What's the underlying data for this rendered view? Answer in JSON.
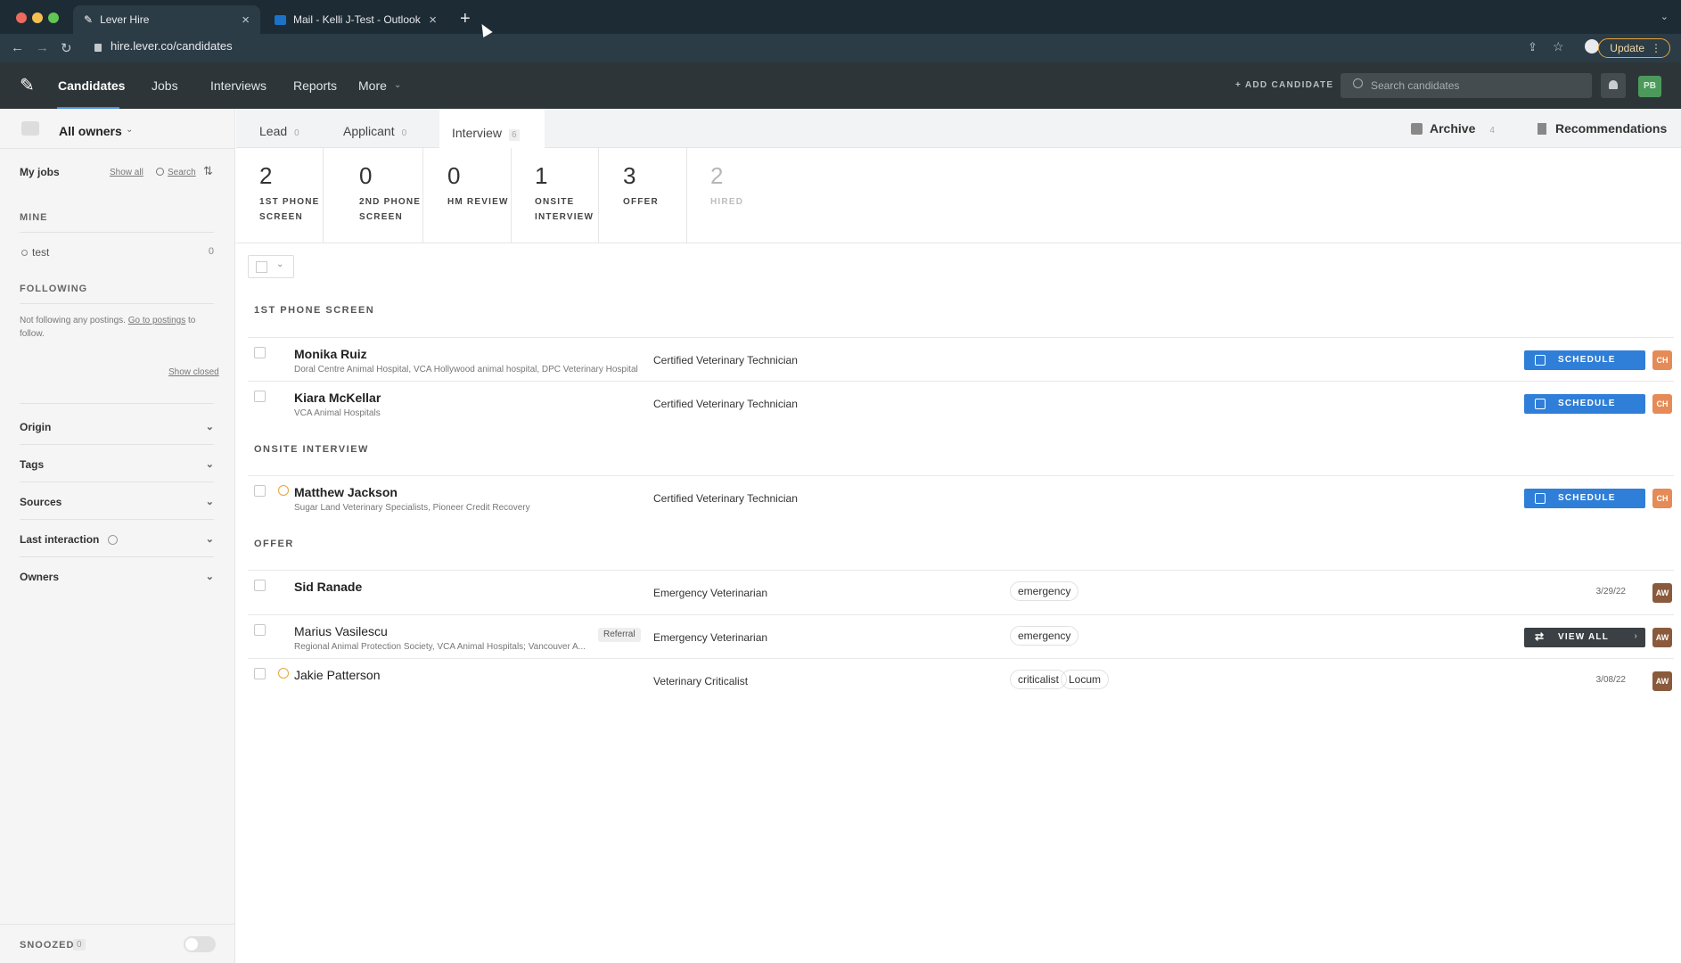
{
  "browser": {
    "tabs": [
      {
        "label": "Lever Hire"
      },
      {
        "label": "Mail - Kelli J-Test - Outlook"
      }
    ],
    "url": "hire.lever.co/candidates",
    "update_label": "Update"
  },
  "appnav": {
    "items": [
      "Candidates",
      "Jobs",
      "Interviews",
      "Reports",
      "More"
    ],
    "add_candidate": "+ ADD CANDIDATE",
    "search_placeholder": "Search candidates",
    "user_initials": "PB"
  },
  "sidebar": {
    "owners_label": "All owners",
    "my_jobs": "My jobs",
    "show_all": "Show all",
    "search": "Search",
    "mine_label": "MINE",
    "mine_items": [
      {
        "label": "test",
        "count": "0"
      }
    ],
    "following_label": "FOLLOWING",
    "following_text_1": "Not following any postings.",
    "following_link": "Go to postings",
    "following_text_2": "to follow.",
    "show_closed": "Show closed",
    "filters": [
      "Origin",
      "Tags",
      "Sources",
      "Last interaction",
      "Owners"
    ],
    "snoozed_label": "SNOOZED",
    "snoozed_count": "0"
  },
  "stages": {
    "tabs": [
      {
        "label": "Lead",
        "count": "0"
      },
      {
        "label": "Applicant",
        "count": "0"
      },
      {
        "label": "Interview",
        "count": "6"
      }
    ],
    "archive_label": "Archive",
    "archive_count": "4",
    "recommendations_label": "Recommendations",
    "substages": [
      {
        "num": "2",
        "line1": "1ST PHONE",
        "line2": "SCREEN"
      },
      {
        "num": "0",
        "line1": "2ND PHONE",
        "line2": "SCREEN"
      },
      {
        "num": "0",
        "line1": "HM REVIEW",
        "line2": ""
      },
      {
        "num": "1",
        "line1": "ONSITE",
        "line2": "INTERVIEW"
      },
      {
        "num": "3",
        "line1": "OFFER",
        "line2": ""
      },
      {
        "num": "2",
        "line1": "HIRED",
        "line2": ""
      }
    ]
  },
  "sections": {
    "phone_screen": "1ST PHONE SCREEN",
    "onsite": "ONSITE INTERVIEW",
    "offer": "OFFER"
  },
  "candidates": [
    {
      "name": "Monika Ruiz",
      "sub": "Doral Centre Animal Hospital, VCA Hollywood animal hospital, DPC Veterinary Hospital",
      "job": "Certified Veterinary Technician",
      "action": "SCHEDULE",
      "owner": "CH"
    },
    {
      "name": "Kiara McKellar",
      "sub": "VCA Animal Hospitals",
      "job": "Certified Veterinary Technician",
      "action": "SCHEDULE",
      "owner": "CH"
    },
    {
      "name": "Matthew Jackson",
      "sub": "Sugar Land Veterinary Specialists, Pioneer Credit Recovery",
      "job": "Certified Veterinary Technician",
      "action": "SCHEDULE",
      "owner": "CH"
    },
    {
      "name": "Sid Ranade",
      "sub": "",
      "job": "Emergency Veterinarian",
      "tags": [
        "emergency"
      ],
      "date": "3/29/22",
      "owner": "AW"
    },
    {
      "name": "Marius Vasilescu",
      "sub": "Regional Animal Protection Society, VCA Animal Hospitals; Vancouver A...",
      "referral": "Referral",
      "job": "Emergency Veterinarian",
      "tags": [
        "emergency"
      ],
      "action": "VIEW ALL",
      "owner": "AW"
    },
    {
      "name": "Jakie Patterson",
      "sub": "",
      "job": "Veterinary Criticalist",
      "tags": [
        "criticalist",
        "Locum"
      ],
      "date": "3/08/22",
      "owner": "AW"
    }
  ],
  "colors": {
    "accent": "#2f7fd8",
    "nav_bg": "#2e3538",
    "owner_ch": "#e58b57",
    "owner_aw": "#8a5a3c"
  }
}
